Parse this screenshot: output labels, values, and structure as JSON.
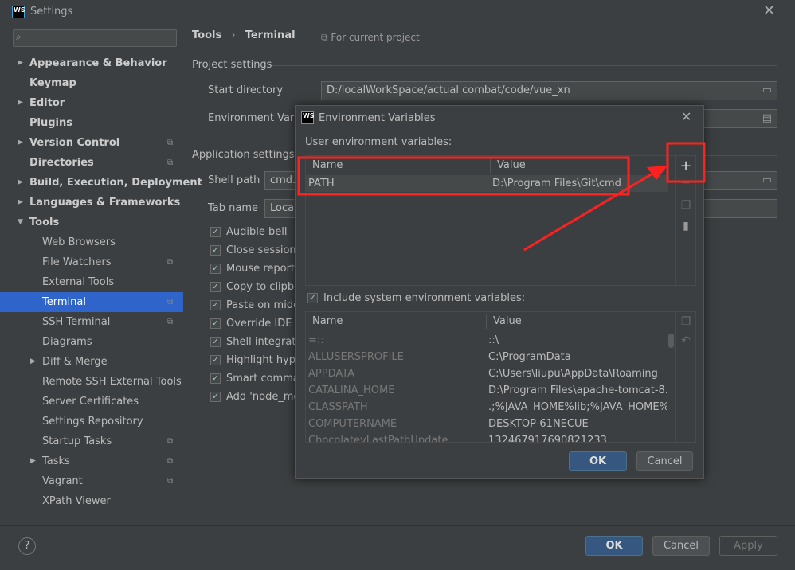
{
  "window": {
    "title": "Settings",
    "logo": "WS"
  },
  "sidebar": {
    "search_placeholder": "",
    "items": [
      {
        "label": "Appearance & Behavior",
        "bold": true,
        "arrow": "right"
      },
      {
        "label": "Keymap",
        "bold": true
      },
      {
        "label": "Editor",
        "bold": true,
        "arrow": "right"
      },
      {
        "label": "Plugins",
        "bold": true
      },
      {
        "label": "Version Control",
        "bold": true,
        "arrow": "right",
        "copy": true
      },
      {
        "label": "Directories",
        "bold": true,
        "copy": true
      },
      {
        "label": "Build, Execution, Deployment",
        "bold": true,
        "arrow": "right"
      },
      {
        "label": "Languages & Frameworks",
        "bold": true,
        "arrow": "right"
      },
      {
        "label": "Tools",
        "bold": true,
        "arrow": "down"
      },
      {
        "label": "Web Browsers",
        "indent": 1
      },
      {
        "label": "File Watchers",
        "indent": 1,
        "copy": true
      },
      {
        "label": "External Tools",
        "indent": 1
      },
      {
        "label": "Terminal",
        "indent": 1,
        "copy": true,
        "selected": true
      },
      {
        "label": "SSH Terminal",
        "indent": 1,
        "copy": true
      },
      {
        "label": "Diagrams",
        "indent": 1
      },
      {
        "label": "Diff & Merge",
        "indent": 1,
        "arrow": "right"
      },
      {
        "label": "Remote SSH External Tools",
        "indent": 1
      },
      {
        "label": "Server Certificates",
        "indent": 1
      },
      {
        "label": "Settings Repository",
        "indent": 1
      },
      {
        "label": "Startup Tasks",
        "indent": 1,
        "copy": true
      },
      {
        "label": "Tasks",
        "indent": 1,
        "arrow": "right",
        "copy": true
      },
      {
        "label": "Vagrant",
        "indent": 1,
        "copy": true
      },
      {
        "label": "XPath Viewer",
        "indent": 1
      }
    ]
  },
  "main": {
    "breadcrumb": [
      "Tools",
      "Terminal"
    ],
    "scope": "For current project",
    "project_settings": "Project settings",
    "start_directory_label": "Start directory",
    "start_directory_value": "D:/localWorkSpace/actual combat/code/vue_xn",
    "env_vars_label": "Environment Variał",
    "app_settings": "Application settings",
    "shell_path_label": "Shell path",
    "shell_path_value": "cmd.e",
    "tab_name_label": "Tab name",
    "tab_name_value": "Local",
    "checkboxes": [
      {
        "label": "Audible bell",
        "checked": true
      },
      {
        "label": "Close session w",
        "checked": true
      },
      {
        "label": "Mouse reporti",
        "checked": true
      },
      {
        "label": "Copy to clipbo",
        "checked": true
      },
      {
        "label": "Paste on midd",
        "checked": true
      },
      {
        "label": "Override IDE s",
        "checked": true
      },
      {
        "label": "Shell integratic",
        "checked": true
      },
      {
        "label": "Highlight hype",
        "checked": true
      },
      {
        "label": "Smart commar",
        "checked": true
      },
      {
        "label": "Add 'node_mo",
        "checked": true
      }
    ]
  },
  "footer": {
    "help": "?",
    "ok": "OK",
    "cancel": "Cancel",
    "apply": "Apply"
  },
  "dialog": {
    "title": "Environment Variables",
    "user_label": "User environment variables:",
    "columns": [
      "Name",
      "Value"
    ],
    "user_rows": [
      {
        "name": "PATH",
        "value": "D:\\Program Files\\Git\\cmd"
      }
    ],
    "include_system_label": "Include system environment variables:",
    "include_system": true,
    "system_rows": [
      {
        "name": "=::",
        "value": "::\\"
      },
      {
        "name": "ALLUSERSPROFILE",
        "value": "C:\\ProgramData"
      },
      {
        "name": "APPDATA",
        "value": "C:\\Users\\liupu\\AppData\\Roaming"
      },
      {
        "name": "CATALINA_HOME",
        "value": "D:\\Program Files\\apache-tomcat-8.0..."
      },
      {
        "name": "CLASSPATH",
        "value": ".;%JAVA_HOME%lib;%JAVA_HOME%..."
      },
      {
        "name": "COMPUTERNAME",
        "value": "DESKTOP-61NECUE"
      },
      {
        "name": "ChocolateyLastPathUpdate",
        "value": "132467917690821233"
      }
    ],
    "ok": "OK",
    "cancel": "Cancel"
  },
  "annotation_color": "#ff2020"
}
